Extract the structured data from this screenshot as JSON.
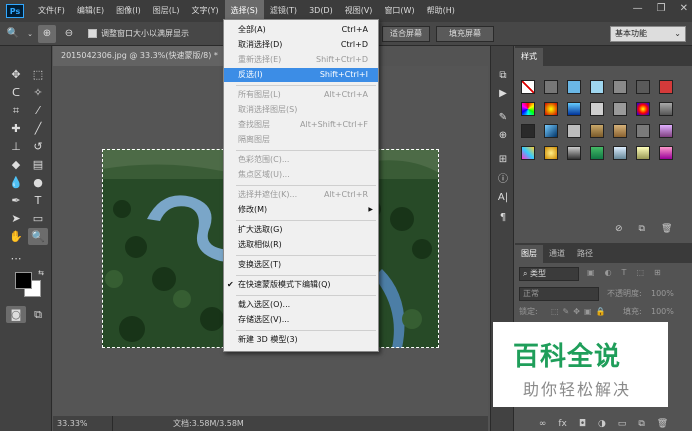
{
  "app": {
    "logo": "Ps"
  },
  "menubar": [
    "文件(F)",
    "编辑(E)",
    "图像(I)",
    "图层(L)",
    "文字(Y)",
    "选择(S)",
    "滤镜(T)",
    "3D(D)",
    "视图(V)",
    "窗口(W)",
    "帮助(H)"
  ],
  "options": {
    "resize_windows_label": "调整窗口大小以满屏显示",
    "fit_screen": "适合屏幕",
    "fill_screen": "填充屏幕",
    "workspace": "基本功能"
  },
  "document": {
    "tab_title": "2015042306.jpg @ 33.3%(快速蒙版/8) *",
    "zoom": "33.33%",
    "doc_size": "文档:3.58M/3.58M"
  },
  "select_menu": [
    {
      "label": "全部(A)",
      "shortcut": "Ctrl+A",
      "state": "normal"
    },
    {
      "label": "取消选择(D)",
      "shortcut": "Ctrl+D",
      "state": "normal"
    },
    {
      "label": "重新选择(E)",
      "shortcut": "Shift+Ctrl+D",
      "state": "disabled"
    },
    {
      "label": "反选(I)",
      "shortcut": "Shift+Ctrl+I",
      "state": "highlighted"
    },
    {
      "sep": true
    },
    {
      "label": "所有图层(L)",
      "shortcut": "Alt+Ctrl+A",
      "state": "disabled"
    },
    {
      "label": "取消选择图层(S)",
      "shortcut": "",
      "state": "disabled"
    },
    {
      "label": "查找图层",
      "shortcut": "Alt+Shift+Ctrl+F",
      "state": "disabled"
    },
    {
      "label": "隔离图层",
      "shortcut": "",
      "state": "disabled"
    },
    {
      "sep": true
    },
    {
      "label": "色彩范围(C)...",
      "shortcut": "",
      "state": "disabled"
    },
    {
      "label": "焦点区域(U)...",
      "shortcut": "",
      "state": "disabled"
    },
    {
      "sep": true
    },
    {
      "label": "选择并遮住(K)...",
      "shortcut": "Alt+Ctrl+R",
      "state": "disabled"
    },
    {
      "label": "修改(M)",
      "shortcut": "",
      "state": "normal",
      "submenu": true
    },
    {
      "sep": true
    },
    {
      "label": "扩大选取(G)",
      "shortcut": "",
      "state": "normal"
    },
    {
      "label": "选取相似(R)",
      "shortcut": "",
      "state": "normal"
    },
    {
      "sep": true
    },
    {
      "label": "变换选区(T)",
      "shortcut": "",
      "state": "normal"
    },
    {
      "sep": true
    },
    {
      "label": "在快速蒙版模式下编辑(Q)",
      "shortcut": "",
      "state": "normal",
      "checked": true
    },
    {
      "sep": true
    },
    {
      "label": "载入选区(O)...",
      "shortcut": "",
      "state": "normal"
    },
    {
      "label": "存储选区(V)...",
      "shortcut": "",
      "state": "normal"
    },
    {
      "sep": true
    },
    {
      "label": "新建 3D 模型(3)",
      "shortcut": "",
      "state": "normal"
    }
  ],
  "styles_panel": {
    "tab": "样式"
  },
  "layers_panel": {
    "tabs": [
      "图层",
      "通道",
      "路径"
    ],
    "kind_filter": "类型",
    "blend_mode": "正常",
    "opacity_label": "不透明度:",
    "opacity_value": "100%",
    "lock_label": "锁定:",
    "fill_label": "填充:",
    "fill_value": "100%"
  },
  "watermark": {
    "title": "百科全说",
    "subtitle": "助你轻松解决"
  },
  "colors": {
    "highlight": "#3c8de6",
    "watermark_green": "#1f9e5a"
  }
}
